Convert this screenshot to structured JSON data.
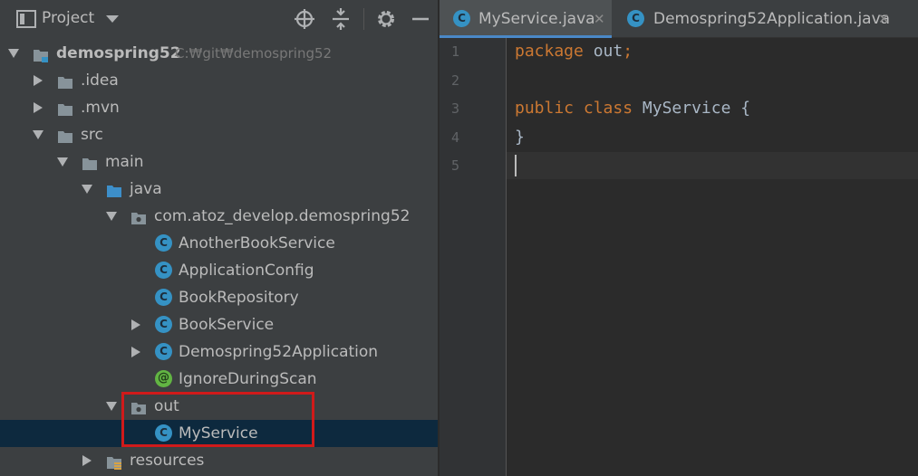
{
  "project_panel": {
    "title": "Project",
    "icons": [
      "locate-icon",
      "collapse-all-icon",
      "settings-icon",
      "hide-icon"
    ]
  },
  "tree": [
    {
      "label": "demospring52",
      "path": "C:₩git₩demospring52",
      "level": 0,
      "arrow": "down",
      "icon": "module-folder"
    },
    {
      "label": ".idea",
      "level": 1,
      "arrow": "right",
      "icon": "folder"
    },
    {
      "label": ".mvn",
      "level": 1,
      "arrow": "right",
      "icon": "folder"
    },
    {
      "label": "src",
      "level": 1,
      "arrow": "down",
      "icon": "folder"
    },
    {
      "label": "main",
      "level": 2,
      "arrow": "down",
      "icon": "folder"
    },
    {
      "label": "java",
      "level": 3,
      "arrow": "down",
      "icon": "source-folder"
    },
    {
      "label": "com.atoz_develop.demospring52",
      "level": 4,
      "arrow": "down",
      "icon": "package"
    },
    {
      "label": "AnotherBookService",
      "level": 5,
      "arrow": "none",
      "icon": "class"
    },
    {
      "label": "ApplicationConfig",
      "level": 5,
      "arrow": "none",
      "icon": "class"
    },
    {
      "label": "BookRepository",
      "level": 5,
      "arrow": "none",
      "icon": "class"
    },
    {
      "label": "BookService",
      "level": 5,
      "arrow": "right",
      "icon": "class"
    },
    {
      "label": "Demospring52Application",
      "level": 5,
      "arrow": "right",
      "icon": "spring-boot-class"
    },
    {
      "label": "IgnoreDuringScan",
      "level": 5,
      "arrow": "none",
      "icon": "annotation"
    },
    {
      "label": "out",
      "level": 4,
      "arrow": "down",
      "icon": "package"
    },
    {
      "label": "MyService",
      "level": 5,
      "arrow": "none",
      "icon": "class",
      "selected": true
    },
    {
      "label": "resources",
      "level": 3,
      "arrow": "right",
      "icon": "resources-folder"
    }
  ],
  "class_badge_letter": "C",
  "annotation_badge_letter": "@",
  "editor": {
    "tabs": [
      {
        "label": "MyService.java",
        "active": true,
        "icon": "class"
      },
      {
        "label": "Demospring52Application.java",
        "active": false,
        "icon": "spring-boot-class"
      }
    ],
    "close_glyph": "✕",
    "line_numbers": [
      "1",
      "2",
      "3",
      "4",
      "5"
    ],
    "code_lines": [
      [
        {
          "t": "package ",
          "c": "kw"
        },
        {
          "t": "out",
          "c": "id"
        },
        {
          "t": ";",
          "c": "kw"
        }
      ],
      [],
      [
        {
          "t": "public ",
          "c": "kw"
        },
        {
          "t": "class ",
          "c": "kw"
        },
        {
          "t": "MyService {",
          "c": "id"
        }
      ],
      [
        {
          "t": "}",
          "c": "id"
        }
      ],
      []
    ]
  },
  "colors": {
    "panel_bg": "#3c3f41",
    "editor_bg": "#2b2b2b",
    "selection": "#0d293e",
    "keyword": "#cc7832",
    "identifier": "#a9b7c6",
    "class_badge": "#3592c4",
    "annotation_badge": "#62b543",
    "highlight_box": "#d01a1a"
  }
}
